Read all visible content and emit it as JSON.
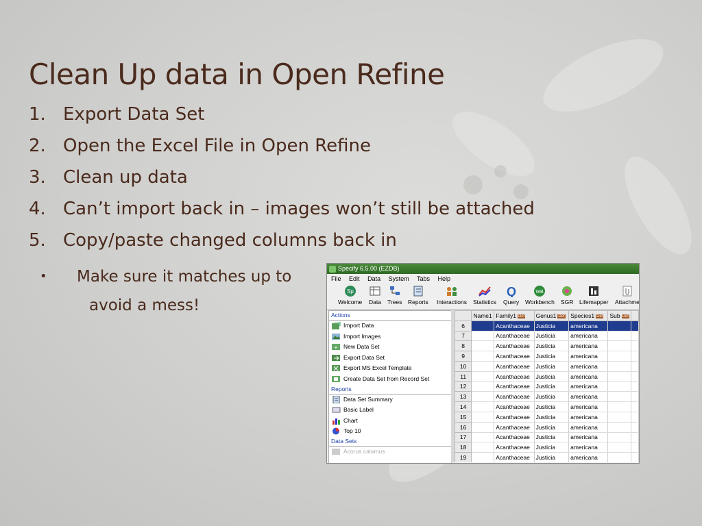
{
  "slide": {
    "title": "Clean Up data in Open Refine",
    "steps": [
      {
        "num": "1.",
        "text": "Export Data Set"
      },
      {
        "num": "2.",
        "text": "Open the Excel File in Open Refine"
      },
      {
        "num": "3.",
        "text": "Clean up data"
      },
      {
        "num": "4.",
        "text": "Can’t import back in – images won’t still be attached"
      },
      {
        "num": "5.",
        "text": "Copy/paste changed columns back in"
      }
    ],
    "sub_bullet": {
      "marker": "•",
      "line1": "Make sure it matches up to",
      "line2": "avoid a mess!"
    }
  },
  "app": {
    "title": "Specify 6.5.00 (EZDB)",
    "menu": [
      "File",
      "Edit",
      "Data",
      "System",
      "Tabs",
      "Help"
    ],
    "toolbar": [
      "Welcome",
      "Data",
      "Trees",
      "Reports",
      "Interactions",
      "Statistics",
      "Query",
      "Workbench",
      "SGR",
      "Lifemapper",
      "Attachme"
    ],
    "sections": {
      "actions": {
        "label": "Actions",
        "items": [
          "Import Data",
          "Import Images",
          "New Data Set",
          "Export Data Set",
          "Export MS Excel Template",
          "Create Data Set from Record Set"
        ]
      },
      "reports": {
        "label": "Reports",
        "items": [
          "Data Set Summary",
          "Basic Label",
          "Chart",
          "Top 10"
        ]
      },
      "datasets": {
        "label": "Data Sets",
        "items": [
          "Acorus calamus"
        ]
      }
    },
    "grid": {
      "columns": [
        "Name1",
        "Family1",
        "Genus1",
        "Species1",
        "Sub"
      ],
      "def_badge": "Def",
      "rows": [
        {
          "n": "6",
          "family": "Acanthaceae",
          "genus": "Justicia",
          "species": "americana"
        },
        {
          "n": "7",
          "family": "Acanthaceae",
          "genus": "Justicia",
          "species": "americana"
        },
        {
          "n": "8",
          "family": "Acanthaceae",
          "genus": "Justicia",
          "species": "americana"
        },
        {
          "n": "9",
          "family": "Acanthaceae",
          "genus": "Justicia",
          "species": "americana"
        },
        {
          "n": "10",
          "family": "Acanthaceae",
          "genus": "Justicia",
          "species": "americana"
        },
        {
          "n": "11",
          "family": "Acanthaceae",
          "genus": "Justicia",
          "species": "americana"
        },
        {
          "n": "12",
          "family": "Acanthaceae",
          "genus": "Justicia",
          "species": "americana"
        },
        {
          "n": "13",
          "family": "Acanthaceae",
          "genus": "Justicia",
          "species": "americana"
        },
        {
          "n": "14",
          "family": "Acanthaceae",
          "genus": "Justicia",
          "species": "americana"
        },
        {
          "n": "15",
          "family": "Acanthaceae",
          "genus": "Justicia",
          "species": "americana"
        },
        {
          "n": "16",
          "family": "Acanthaceae",
          "genus": "Justicia",
          "species": "americana"
        },
        {
          "n": "17",
          "family": "Acanthaceae",
          "genus": "Justicia",
          "species": "americana"
        },
        {
          "n": "18",
          "family": "Acanthaceae",
          "genus": "Justicia",
          "species": "americana"
        },
        {
          "n": "19",
          "family": "Acanthaceae",
          "genus": "Justicia",
          "species": "americana"
        },
        {
          "n": "20",
          "family": "Acanthaceae",
          "genus": "Justicia",
          "species": "americana"
        }
      ]
    }
  },
  "colors": {
    "text": "#4a2a1c",
    "selection": "#1f3c8f",
    "link": "#1a3fa8"
  }
}
